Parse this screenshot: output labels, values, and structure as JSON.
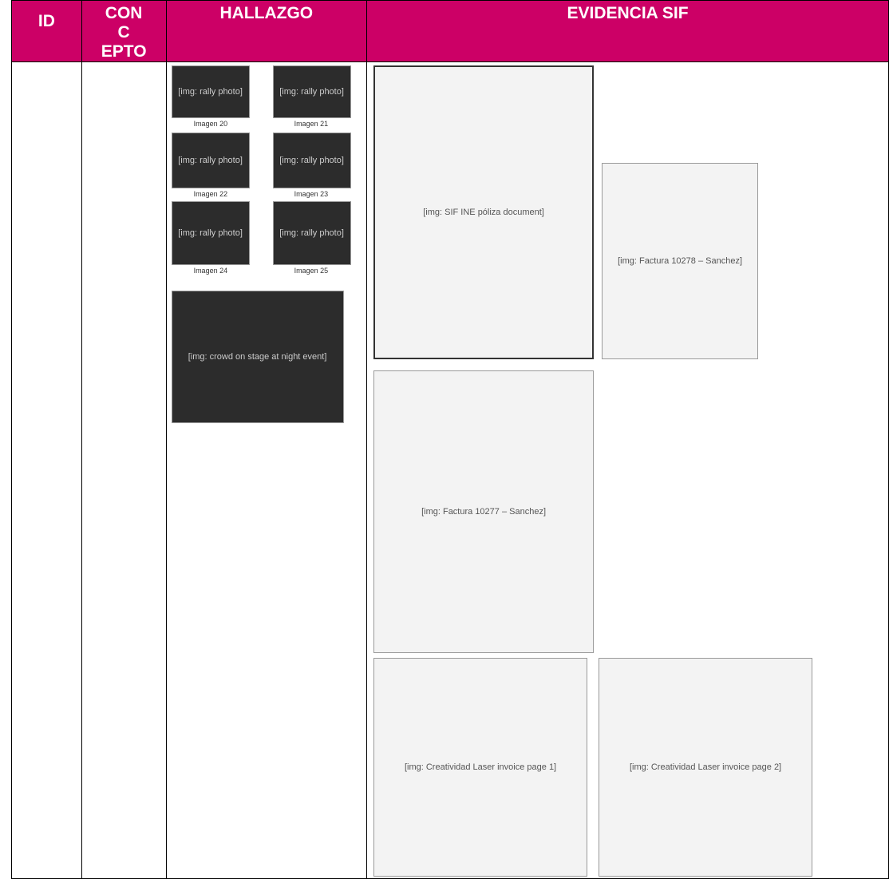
{
  "colors": {
    "accent": "#cc0066"
  },
  "table": {
    "headers": {
      "id": "ID",
      "concepto": "CONC EPTO",
      "hallazgo": "HALLAZGO",
      "evidencia": "EVIDENCIA SIF"
    }
  },
  "hallazgo": {
    "captions": [
      "Imagen 20",
      "Imagen 21",
      "Imagen 22",
      "Imagen 23",
      "Imagen 24",
      "Imagen 25"
    ],
    "photo_placeholders": [
      "[img: rally photo]",
      "[img: rally photo]",
      "[img: rally photo]",
      "[img: rally photo]",
      "[img: rally photo]",
      "[img: rally photo]"
    ],
    "stage_photo": "[img: crowd on stage at night event]"
  },
  "evidencia": {
    "sif_poliza": "[img: SIF INE póliza document]",
    "factura_1": "[img: Factura 10278 – Sanchez]",
    "factura_2": "[img: Factura 10277 – Sanchez]",
    "creatividad_1": "[img: Creatividad Laser invoice page 1]",
    "creatividad_2": "[img: Creatividad Laser invoice page 2]"
  }
}
